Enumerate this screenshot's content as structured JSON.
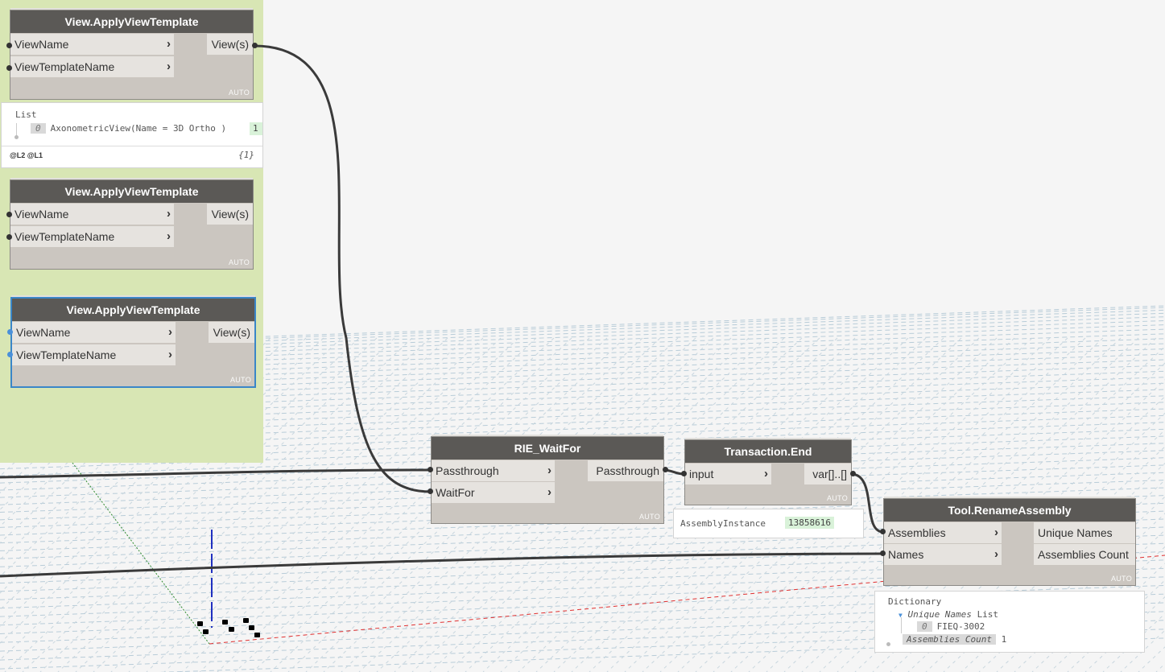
{
  "nodes": {
    "apply1": {
      "title": "View.ApplyViewTemplate",
      "in1": "ViewName",
      "in2": "ViewTemplateName",
      "out1": "View(s)",
      "auto": "AUTO"
    },
    "apply1_preview": {
      "header": "List",
      "index": "0",
      "value": "AxonometricView(Name = 3D Ortho )",
      "count_chip": "1",
      "levels": "@L2 @L1",
      "count": "{1}"
    },
    "apply2": {
      "title": "View.ApplyViewTemplate",
      "in1": "ViewName",
      "in2": "ViewTemplateName",
      "out1": "View(s)",
      "auto": "AUTO"
    },
    "apply3": {
      "title": "View.ApplyViewTemplate",
      "in1": "ViewName",
      "in2": "ViewTemplateName",
      "out1": "View(s)",
      "auto": "AUTO"
    },
    "waitfor": {
      "title": "RIE_WaitFor",
      "in1": "Passthrough",
      "in2": "WaitFor",
      "out1": "Passthrough",
      "auto": "AUTO"
    },
    "transaction": {
      "title": "Transaction.End",
      "in1": "input",
      "out1": "var[]..[]",
      "auto": "AUTO"
    },
    "transaction_preview": {
      "label": "AssemblyInstance",
      "value": "13858616"
    },
    "rename": {
      "title": "Tool.RenameAssembly",
      "in1": "Assemblies",
      "in2": "Names",
      "out1": "Unique Names",
      "out2": "Assemblies Count",
      "auto": "AUTO"
    },
    "rename_preview": {
      "header": "Dictionary",
      "key1": "Unique Names",
      "key1_type": "List",
      "index": "0",
      "item": "FIEQ-3002",
      "key2": "Assemblies Count",
      "key2_value": "1"
    }
  },
  "colors": {
    "group": "#d8e6b4",
    "header": "#5b5956",
    "body": "#cbc6c0",
    "port": "#e6e3df",
    "selected": "#3a86c8",
    "wire": "#3a3a3a"
  }
}
